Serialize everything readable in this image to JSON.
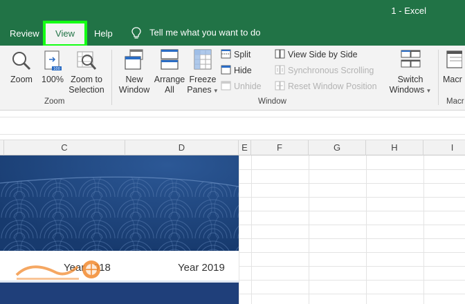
{
  "window": {
    "title": "1  -  Excel"
  },
  "tabs": {
    "review": "Review",
    "view": "View",
    "help": "Help"
  },
  "tell_me": "Tell me what you want to do",
  "ribbon": {
    "zoom_group": {
      "label": "Zoom",
      "zoom": "Zoom",
      "hundred": "100%",
      "zoom_to_selection_1": "Zoom to",
      "zoom_to_selection_2": "Selection"
    },
    "window_group": {
      "label": "Window",
      "new_window_1": "New",
      "new_window_2": "Window",
      "arrange_all_1": "Arrange",
      "arrange_all_2": "All",
      "freeze_panes_1": "Freeze",
      "freeze_panes_2": "Panes",
      "split": "Split",
      "hide": "Hide",
      "unhide": "Unhide",
      "view_side_by_side": "View Side by Side",
      "synchronous_scrolling": "Synchronous Scrolling",
      "reset_window_position": "Reset Window Position",
      "switch_windows_1": "Switch",
      "switch_windows_2": "Windows"
    },
    "macros_group": {
      "label": "Macr",
      "macros": "Macr"
    }
  },
  "columns": [
    "C",
    "D",
    "E",
    "F",
    "G",
    "H",
    "I"
  ],
  "sheet": {
    "year1": "Year 2018",
    "year2": "Year 2019"
  },
  "colors": {
    "excel_green": "#217346",
    "highlight": "#14ff14",
    "banner_blue": "#1f3f7a"
  }
}
